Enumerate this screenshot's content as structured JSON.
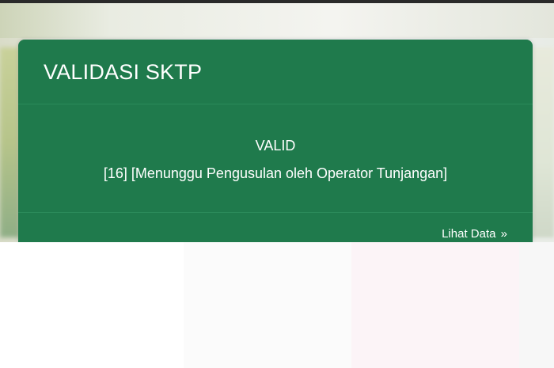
{
  "card": {
    "title": "VALIDASI SKTP",
    "status": "VALID",
    "detail": "[16] [Menunggu Pengusulan oleh Operator Tunjangan]",
    "link_label": "Lihat Data",
    "link_icon": "double-chevron-right-icon"
  },
  "colors": {
    "card_background": "#1f7a4c",
    "text": "#ffffff"
  }
}
